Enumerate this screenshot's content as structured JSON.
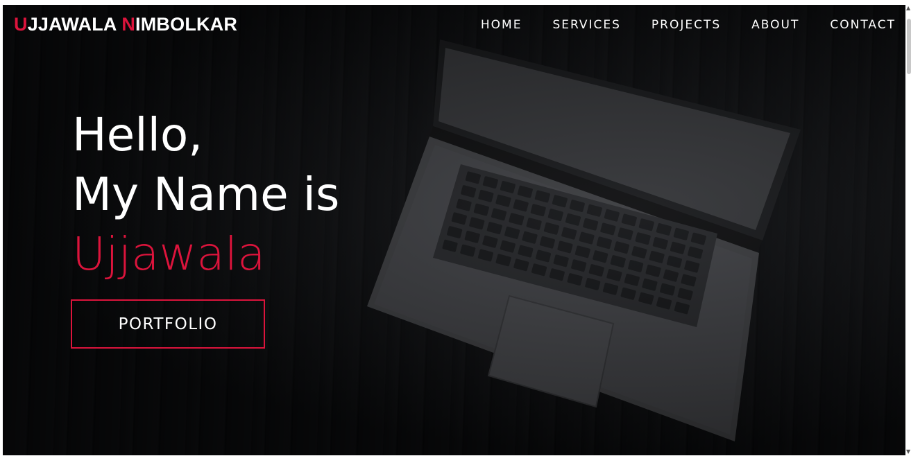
{
  "brand": {
    "initial_first": "U",
    "rest_first": "JJAWALA ",
    "initial_last": "N",
    "rest_last": "IMBOLKAR"
  },
  "nav": {
    "items": [
      "HOME",
      "SERVICES",
      "PROJECTS",
      "ABOUT",
      "CONTACT"
    ]
  },
  "hero": {
    "line1": "Hello,",
    "line2": "My Name is",
    "name": "Ujjawala",
    "button_label": "PORTFOLIO"
  },
  "colors": {
    "accent": "#dc143c",
    "background": "#0a0b0d",
    "text": "#ffffff"
  }
}
